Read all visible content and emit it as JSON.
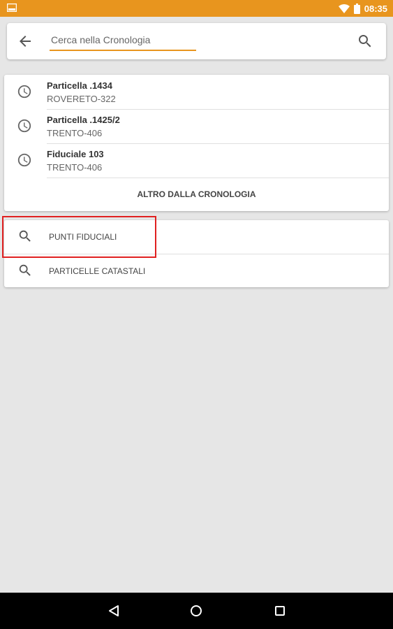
{
  "status_bar": {
    "time": "08:35",
    "bg_color": "#e8951e",
    "icons": [
      "screenshot-icon",
      "wifi-icon",
      "battery-icon"
    ]
  },
  "search": {
    "placeholder": "Cerca nella Cronologia",
    "accent_color": "#e8951e"
  },
  "history": {
    "items": [
      {
        "title": "Particella .1434",
        "subtitle": "ROVERETO-322"
      },
      {
        "title": "Particella .1425/2",
        "subtitle": "TRENTO-406"
      },
      {
        "title": "Fiduciale 103",
        "subtitle": "TRENTO-406"
      }
    ],
    "more_label": "ALTRO DALLA CRONOLOGIA"
  },
  "categories": {
    "items": [
      {
        "label": "PUNTI FIDUCIALI"
      },
      {
        "label": "PARTICELLE CATASTALI"
      }
    ]
  },
  "highlight_color": "#e02020"
}
